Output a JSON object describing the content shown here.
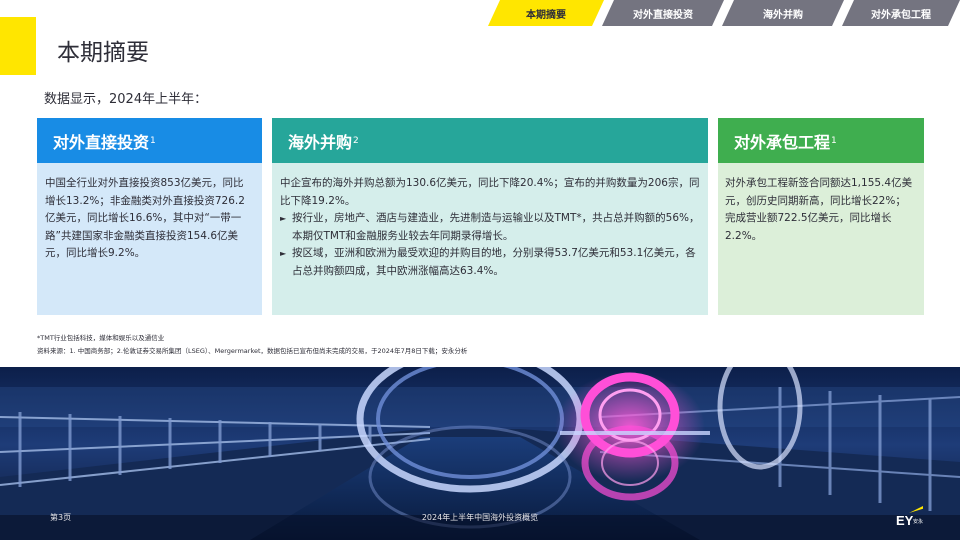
{
  "tabs": [
    {
      "label": "本期摘要",
      "active": true
    },
    {
      "label": "对外直接投资",
      "active": false
    },
    {
      "label": "海外并购",
      "active": false
    },
    {
      "label": "对外承包工程",
      "active": false
    }
  ],
  "title": "本期摘要",
  "intro": "数据显示，2024年上半年：",
  "cards": {
    "fdi": {
      "heading": "对外直接投资",
      "sup": "1",
      "color": "#188ce5",
      "body": "中国全行业对外直接投资853亿美元，同比增长13.2%；非金融类对外直接投资726.2亿美元，同比增长16.6%，其中对“一带一路”共建国家非金融类直接投资154.6亿美元，同比增长9.2%。"
    },
    "ma": {
      "heading": "海外并购",
      "sup": "2",
      "color": "#26a69a",
      "body": "中企宣布的海外并购总额为130.6亿美元，同比下降20.4%；宣布的并购数量为206宗，同比下降19.2%。",
      "bullets": [
        "按行业，房地产、酒店与建造业，先进制造与运输业以及TMT*，共占总并购额的56%，本期仅TMT和金融服务业较去年同期录得增长。",
        "按区域，亚洲和欧洲为最受欢迎的并购目的地，分别录得53.7亿美元和53.1亿美元，各占总并购额四成，其中欧洲涨幅高达63.4%。"
      ]
    },
    "con": {
      "heading": "对外承包工程",
      "sup": "1",
      "color": "#3fae4f",
      "body": "对外承包工程新签合同额达1,155.4亿美元，创历史同期新高，同比增长22%；完成营业额722.5亿美元，同比增长2.2%。"
    }
  },
  "footnotes": {
    "tmt": "*TMT行业包括科技，媒体和娱乐以及通信业",
    "source": "资料来源：1. 中国商务部；2.伦敦证券交易所集团（LSEG）、Mergermarket，数据包括已宣布但尚未完成的交易，于2024年7月8日下载；安永分析"
  },
  "footer": {
    "page": "第3页",
    "title": "2024年上半年中国海外投资概览",
    "logo": "EY",
    "logo_sub": "安永"
  },
  "colors": {
    "brand_yellow": "#ffe600",
    "tab_grey": "#747480"
  },
  "icons": {
    "bullet": "triangle-right-icon"
  }
}
